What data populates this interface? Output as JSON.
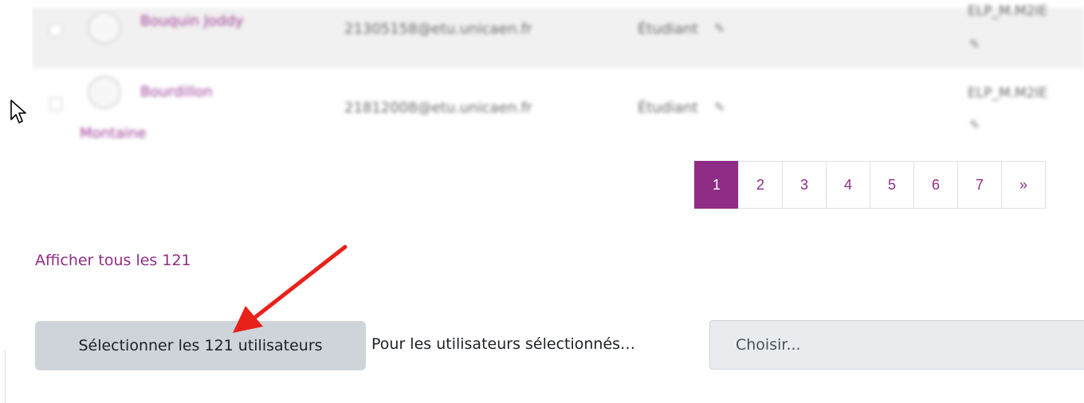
{
  "table": {
    "rows": [
      {
        "name": "Bouquin Joddy",
        "email": "21305158@etu.unicaen.fr",
        "role": "Étudiant",
        "group": "ELP_M.M2IE"
      },
      {
        "name_line1": "Bourdillon",
        "name_line2": "Montaine",
        "email": "21812008@etu.unicaen.fr",
        "role": "Étudiant",
        "group": "ELP_M.M2IE"
      }
    ]
  },
  "pagination": {
    "pages": [
      "1",
      "2",
      "3",
      "4",
      "5",
      "6",
      "7"
    ],
    "next": "»",
    "current": "1"
  },
  "show_all": "Afficher tous les 121",
  "bulk": {
    "select_button": "Sélectionner les 121 utilisateurs",
    "for_selected": "Pour les utilisateurs sélectionnés…",
    "choose_placeholder": "Choisir..."
  },
  "colors": {
    "accent": "#8f2d86",
    "button_bg": "#ced4da",
    "select_bg": "#e9ecef",
    "annotation_arrow": "#e8221b"
  },
  "icons": [
    "pencil-icon",
    "mouse-cursor-icon",
    "annotation-arrow-icon"
  ]
}
